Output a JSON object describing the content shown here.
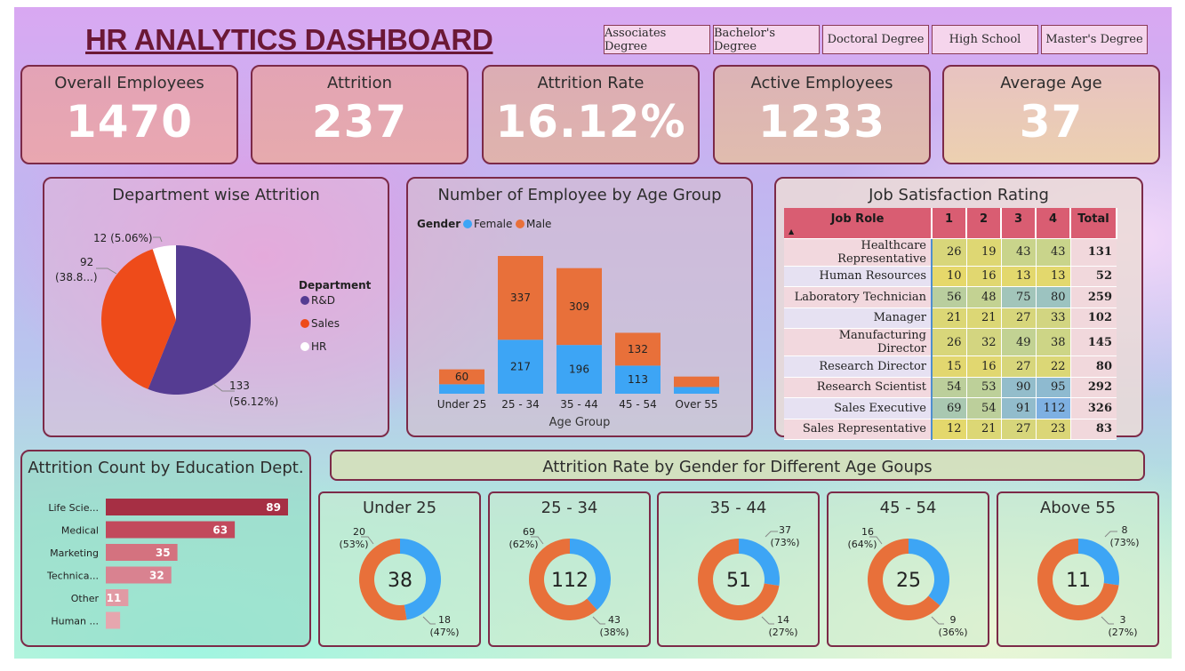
{
  "header": {
    "title": "HR ANALYTICS DASHBOARD"
  },
  "slicers": [
    "Associates Degree",
    "Bachelor's Degree",
    "Doctoral Degree",
    "High School",
    "Master's Degree"
  ],
  "kpis": [
    {
      "label": "Overall Employees",
      "value": "1470"
    },
    {
      "label": "Attrition",
      "value": "237"
    },
    {
      "label": "Attrition Rate",
      "value": "16.12%"
    },
    {
      "label": "Active Employees",
      "value": "1233"
    },
    {
      "label": "Average Age",
      "value": "37"
    }
  ],
  "colors": {
    "rd": "#553c92",
    "sales": "#ee4b1a",
    "hr": "#ffffff",
    "female": "#3da5f5",
    "male": "#e8703a",
    "edu_bar": "#b03a4c",
    "accent": "#7c2a48"
  },
  "chart_data": [
    {
      "type": "pie",
      "title": "Department wise Attrition",
      "legend_title": "Department",
      "legend_placement": "right",
      "slices": [
        {
          "name": "R&D",
          "value": 133,
          "label1": "133",
          "label2": "(56.12%)"
        },
        {
          "name": "Sales",
          "value": 92,
          "label1": "92",
          "label2": "(38.8...)"
        },
        {
          "name": "HR",
          "value": 12,
          "label1": "12 (5.06%)",
          "label2": ""
        }
      ]
    },
    {
      "type": "bar",
      "stacked": true,
      "title": "Number of Employee by Age Group",
      "legend_title": "Gender",
      "xlabel": "Age Group",
      "categories": [
        "Under 25",
        "25 - 34",
        "35 - 44",
        "45 - 54",
        "Over 55"
      ],
      "series": [
        {
          "name": "Female",
          "values": [
            38,
            217,
            196,
            113,
            27
          ],
          "labels": [
            "",
            "217",
            "196",
            "113",
            ""
          ]
        },
        {
          "name": "Male",
          "values": [
            60,
            337,
            309,
            132,
            42
          ],
          "labels": [
            "60",
            "337",
            "309",
            "132",
            ""
          ]
        }
      ]
    },
    {
      "type": "table",
      "title": "Job Satisfaction Rating",
      "columns": [
        "Job Role",
        "1",
        "2",
        "3",
        "4",
        "Total"
      ],
      "rows": [
        [
          "Healthcare Representative",
          26,
          19,
          43,
          43,
          131
        ],
        [
          "Human Resources",
          10,
          16,
          13,
          13,
          52
        ],
        [
          "Laboratory Technician",
          56,
          48,
          75,
          80,
          259
        ],
        [
          "Manager",
          21,
          21,
          27,
          33,
          102
        ],
        [
          "Manufacturing Director",
          26,
          32,
          49,
          38,
          145
        ],
        [
          "Research Director",
          15,
          16,
          27,
          22,
          80
        ],
        [
          "Research Scientist",
          54,
          53,
          90,
          95,
          292
        ],
        [
          "Sales Executive",
          69,
          54,
          91,
          112,
          326
        ],
        [
          "Sales Representative",
          12,
          21,
          27,
          23,
          83
        ]
      ]
    },
    {
      "type": "bar",
      "orientation": "horizontal",
      "title": "Attrition Count by Education Dept.",
      "categories": [
        "Life Scie...",
        "Medical",
        "Marketing",
        "Technica...",
        "Other",
        "Human ..."
      ],
      "values": [
        89,
        63,
        35,
        32,
        11,
        7
      ],
      "labels": [
        "89",
        "63",
        "35",
        "32",
        "11",
        ""
      ]
    },
    {
      "type": "pie",
      "variant": "donut",
      "title": "Attrition Rate by Gender for Different Age Goups",
      "groups": [
        {
          "name": "Under 25",
          "total": "38",
          "male": 20,
          "female": 18,
          "male_label": [
            "20",
            "(53%)"
          ],
          "female_label": [
            "18",
            "(47%)"
          ]
        },
        {
          "name": "25 - 34",
          "total": "112",
          "male": 69,
          "female": 43,
          "male_label": [
            "69",
            "(62%)"
          ],
          "female_label": [
            "43",
            "(38%)"
          ]
        },
        {
          "name": "35 - 44",
          "total": "51",
          "male": 37,
          "female": 14,
          "male_label": [
            "37",
            "(73%)"
          ],
          "female_label": [
            "14",
            "(27%)"
          ]
        },
        {
          "name": "45 - 54",
          "total": "25",
          "male": 16,
          "female": 9,
          "male_label": [
            "16",
            "(64%)"
          ],
          "female_label": [
            "9",
            "(36%)"
          ]
        },
        {
          "name": "Above 55",
          "total": "11",
          "male": 8,
          "female": 3,
          "male_label": [
            "8",
            "(73%)"
          ],
          "female_label": [
            "3",
            "(27%)"
          ]
        }
      ]
    }
  ]
}
